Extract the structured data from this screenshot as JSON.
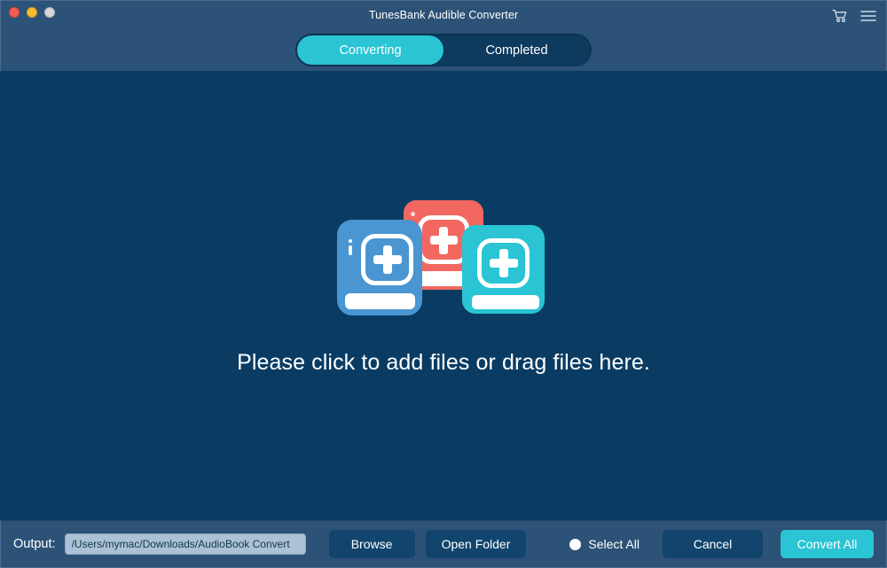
{
  "window": {
    "title": "TunesBank Audible Converter",
    "traffic_lights": [
      "close",
      "minimize",
      "maximize"
    ]
  },
  "header": {
    "cart_icon": "cart-icon",
    "menu_icon": "hamburger-menu-icon"
  },
  "tabs": [
    {
      "label": "Converting",
      "active": true
    },
    {
      "label": "Completed",
      "active": false
    }
  ],
  "main": {
    "dropzone_text": "Please click to add files or drag files here.",
    "illustration": {
      "name": "add-books-illustration",
      "cards": [
        {
          "name": "book-card-red",
          "color": "#f2675f"
        },
        {
          "name": "book-card-teal",
          "color": "#2ac4d4"
        },
        {
          "name": "book-card-blue",
          "color": "#4a96d2"
        }
      ]
    }
  },
  "bottom": {
    "output_label": "Output:",
    "output_path": "/Users/mymac/Downloads/AudioBook Convert",
    "output_placeholder": "/Users/mymac/Downloads/AudioBook Convert",
    "browse_label": "Browse",
    "open_folder_label": "Open Folder",
    "select_all_label": "Select All",
    "cancel_label": "Cancel",
    "convert_all_label": "Convert All"
  },
  "colors": {
    "chrome": "#2d5277",
    "canvas": "#0a3c63",
    "accent": "#2ac4d4",
    "button_dark": "#12456d",
    "red": "#f2675f",
    "blue": "#4a96d2"
  }
}
